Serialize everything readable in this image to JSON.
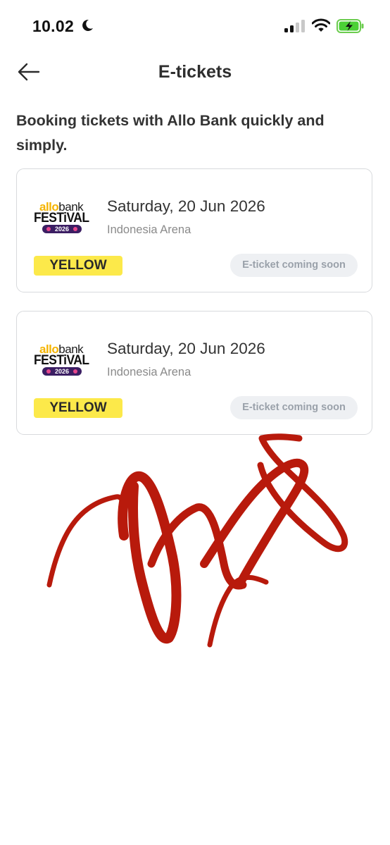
{
  "status_bar": {
    "time": "10.02",
    "icons": [
      "moon-icon",
      "signal-icon",
      "wifi-icon",
      "battery-charging-icon"
    ]
  },
  "header": {
    "title": "E-tickets",
    "back_icon": "arrow-left-icon"
  },
  "intro_text": "Booking tickets with Allo Bank quickly and simply.",
  "tickets": [
    {
      "logo": {
        "line1_a": "allo",
        "line1_b": "bank",
        "line2": "FESTiVAL",
        "year": "2026"
      },
      "date": "Saturday, 20 Jun 2026",
      "venue": "Indonesia Arena",
      "category": "YELLOW",
      "status": "E-ticket coming soon"
    },
    {
      "logo": {
        "line1_a": "allo",
        "line1_b": "bank",
        "line2": "FESTiVAL",
        "year": "2026"
      },
      "date": "Saturday, 20 Jun 2026",
      "venue": "Indonesia Arena",
      "category": "YELLOW",
      "status": "E-ticket coming soon"
    }
  ],
  "colors": {
    "badge_yellow": "#fce94a",
    "scribble_red": "#b81a0c",
    "pill_bg": "#eef0f3"
  }
}
